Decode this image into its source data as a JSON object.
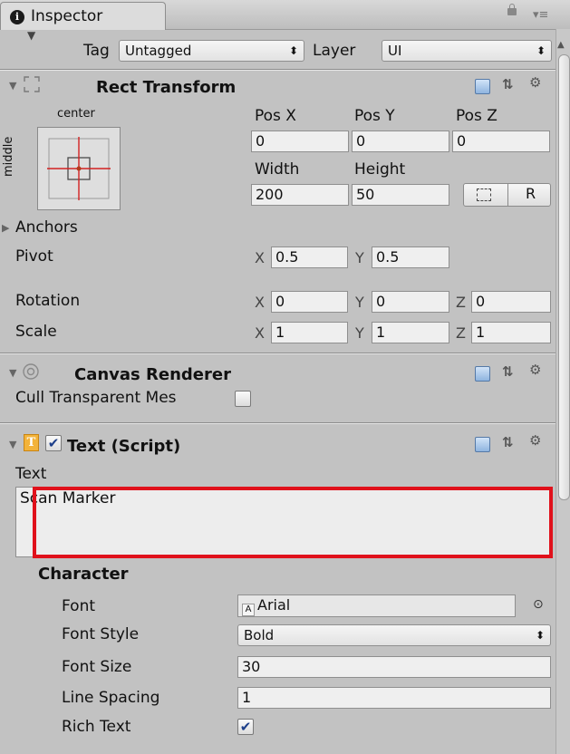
{
  "tab": {
    "title": "Inspector"
  },
  "top": {
    "tag_label": "Tag",
    "tag_value": "Untagged",
    "layer_label": "Layer",
    "layer_value": "UI"
  },
  "rect_transform": {
    "title": "Rect Transform",
    "anchor_top": "center",
    "anchor_side": "middle",
    "pos_x_label": "Pos X",
    "pos_y_label": "Pos Y",
    "pos_z_label": "Pos Z",
    "pos_x": "0",
    "pos_y": "0",
    "pos_z": "0",
    "width_label": "Width",
    "height_label": "Height",
    "width": "200",
    "height": "50",
    "raw_button": "R",
    "anchors_label": "Anchors",
    "pivot_label": "Pivot",
    "pivot_x": "0.5",
    "pivot_y": "0.5",
    "rotation_label": "Rotation",
    "rot_x": "0",
    "rot_y": "0",
    "rot_z": "0",
    "scale_label": "Scale",
    "scale_x": "1",
    "scale_y": "1",
    "scale_z": "1",
    "axis_x": "X",
    "axis_y": "Y",
    "axis_z": "Z"
  },
  "canvas_renderer": {
    "title": "Canvas Renderer",
    "cull_label": "Cull Transparent Mes",
    "cull_checked": false
  },
  "text_script": {
    "title": "Text (Script)",
    "enabled": true,
    "text_label": "Text",
    "text_value": "Scan Marker",
    "character_label": "Character",
    "font_label": "Font",
    "font_value": "Arial",
    "font_style_label": "Font Style",
    "font_style_value": "Bold",
    "font_size_label": "Font Size",
    "font_size_value": "30",
    "line_spacing_label": "Line Spacing",
    "line_spacing_value": "1",
    "rich_text_label": "Rich Text",
    "rich_text_checked": true
  },
  "colors": {
    "highlight_border": "#e0111b",
    "anchor_line": "#d22020",
    "background": "#c2c2c2"
  },
  "icons": [
    "info-icon",
    "lock-icon",
    "menu-icon",
    "rect-transform-icon",
    "canvas-renderer-icon",
    "text-script-icon",
    "help-book-icon",
    "preset-icon",
    "gear-icon",
    "font-asset-icon",
    "object-picker-icon",
    "blueprint-icon"
  ]
}
